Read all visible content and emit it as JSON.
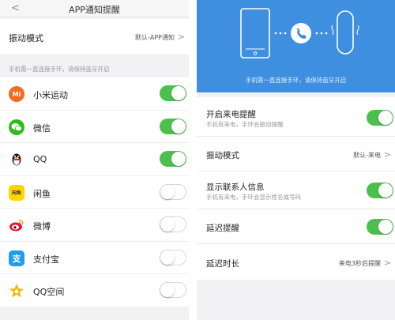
{
  "left": {
    "header": {
      "back_glyph": "<",
      "title": "APP通知提醒"
    },
    "vibration": {
      "label": "振动模式",
      "value": "默认-APP通知"
    },
    "hint": "手机需一直连接手环，请保持蓝牙开启",
    "apps": [
      {
        "name": "小米运动",
        "icon": "mi-fit-icon",
        "icon_text": "Mi",
        "icon_color": "#f36b21",
        "enabled": true
      },
      {
        "name": "微信",
        "icon": "wechat-icon",
        "icon_text": "",
        "icon_color": "#2dbb1f",
        "enabled": true
      },
      {
        "name": "QQ",
        "icon": "qq-penguin-icon",
        "icon_text": "",
        "icon_color": "#ffffff",
        "enabled": true
      },
      {
        "name": "闲鱼",
        "icon": "xianyu-icon",
        "icon_text": "闲鱼",
        "icon_color": "#ffd600",
        "enabled": false
      },
      {
        "name": "微博",
        "icon": "weibo-icon",
        "icon_text": "",
        "icon_color": "#ffffff",
        "enabled": false
      },
      {
        "name": "支付宝",
        "icon": "alipay-icon",
        "icon_text": "支",
        "icon_color": "#1e9cf0",
        "enabled": false
      },
      {
        "name": "QQ空间",
        "icon": "qzone-star-icon",
        "icon_text": "",
        "icon_color": "#ffffff",
        "enabled": false
      }
    ]
  },
  "right": {
    "hero_text": "手机需一直连接手环，请保持蓝牙开启",
    "rows": [
      {
        "title": "开启来电提醒",
        "subtitle": "手机有来电，手环会振动提醒",
        "type": "toggle",
        "enabled": true
      },
      {
        "title": "振动模式",
        "value": "默认-来电",
        "type": "link"
      },
      {
        "title": "显示联系人信息",
        "subtitle": "手机有来电，手环会显示姓名或号码",
        "type": "toggle",
        "enabled": true
      },
      {
        "title": "延迟提醒",
        "type": "toggle",
        "enabled": true
      },
      {
        "title": "延迟时长",
        "value": "来电3秒后提醒",
        "type": "link"
      }
    ]
  },
  "colors": {
    "toggle_on": "#4cc04c",
    "hero_blue": "#3f8fe0",
    "background": "#f2f2f4"
  },
  "chevron_glyph": ">"
}
